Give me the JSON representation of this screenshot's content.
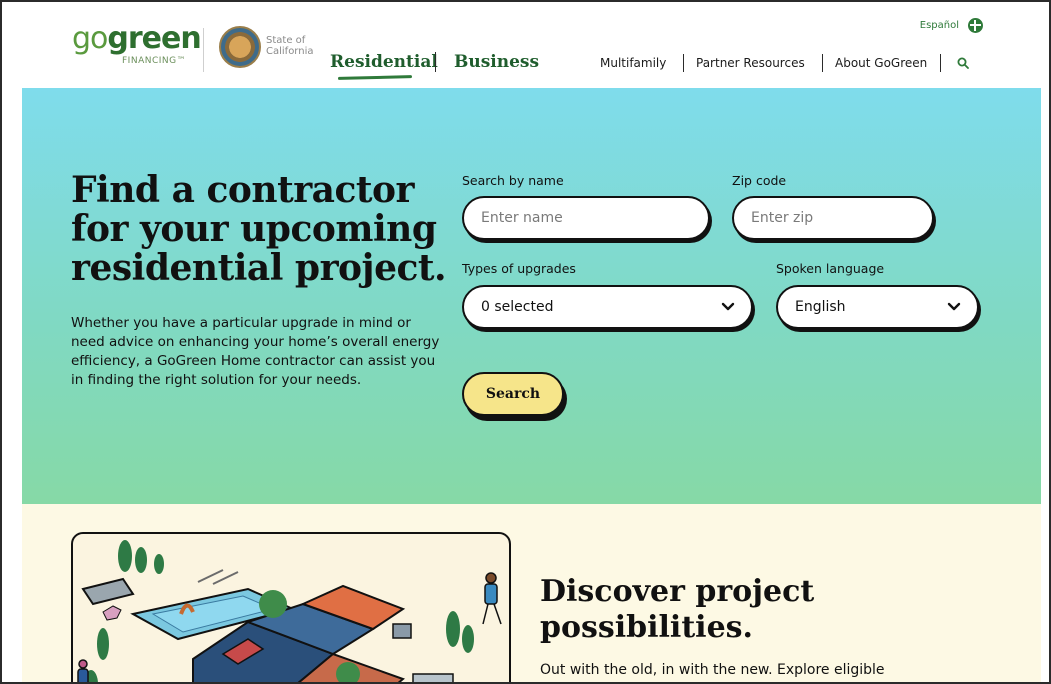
{
  "header": {
    "logo_go": "go",
    "logo_green": "green",
    "logo_sub": "FINANCING™",
    "state_of": "State of",
    "california": "California",
    "lang_link": "Español",
    "nav_main": [
      "Residential",
      "Business"
    ],
    "nav_secondary": [
      "Multifamily",
      "Partner Resources",
      "About GoGreen"
    ]
  },
  "hero": {
    "title": "Find a contractor for your upcoming residential project.",
    "description": "Whether you have a particular upgrade in mind or need advice on enhancing your home’s overall energy efficiency, a GoGreen Home contractor can assist you in finding the right solution for your needs.",
    "form": {
      "name_label": "Search by name",
      "name_placeholder": "Enter name",
      "zip_label": "Zip code",
      "zip_placeholder": "Enter zip",
      "upgrades_label": "Types of upgrades",
      "upgrades_value": "0 selected",
      "language_label": "Spoken language",
      "language_value": "English",
      "search_label": "Search"
    }
  },
  "discover": {
    "title": "Discover project possibilities.",
    "text": "Out with the old, in with the new. Explore eligible"
  },
  "colors": {
    "brand_green": "#2f7a3a",
    "hero_top": "#7fdcec",
    "hero_bottom": "#86d9a6",
    "button_yellow": "#f6e58a",
    "lower_bg": "#fdf9e4"
  }
}
